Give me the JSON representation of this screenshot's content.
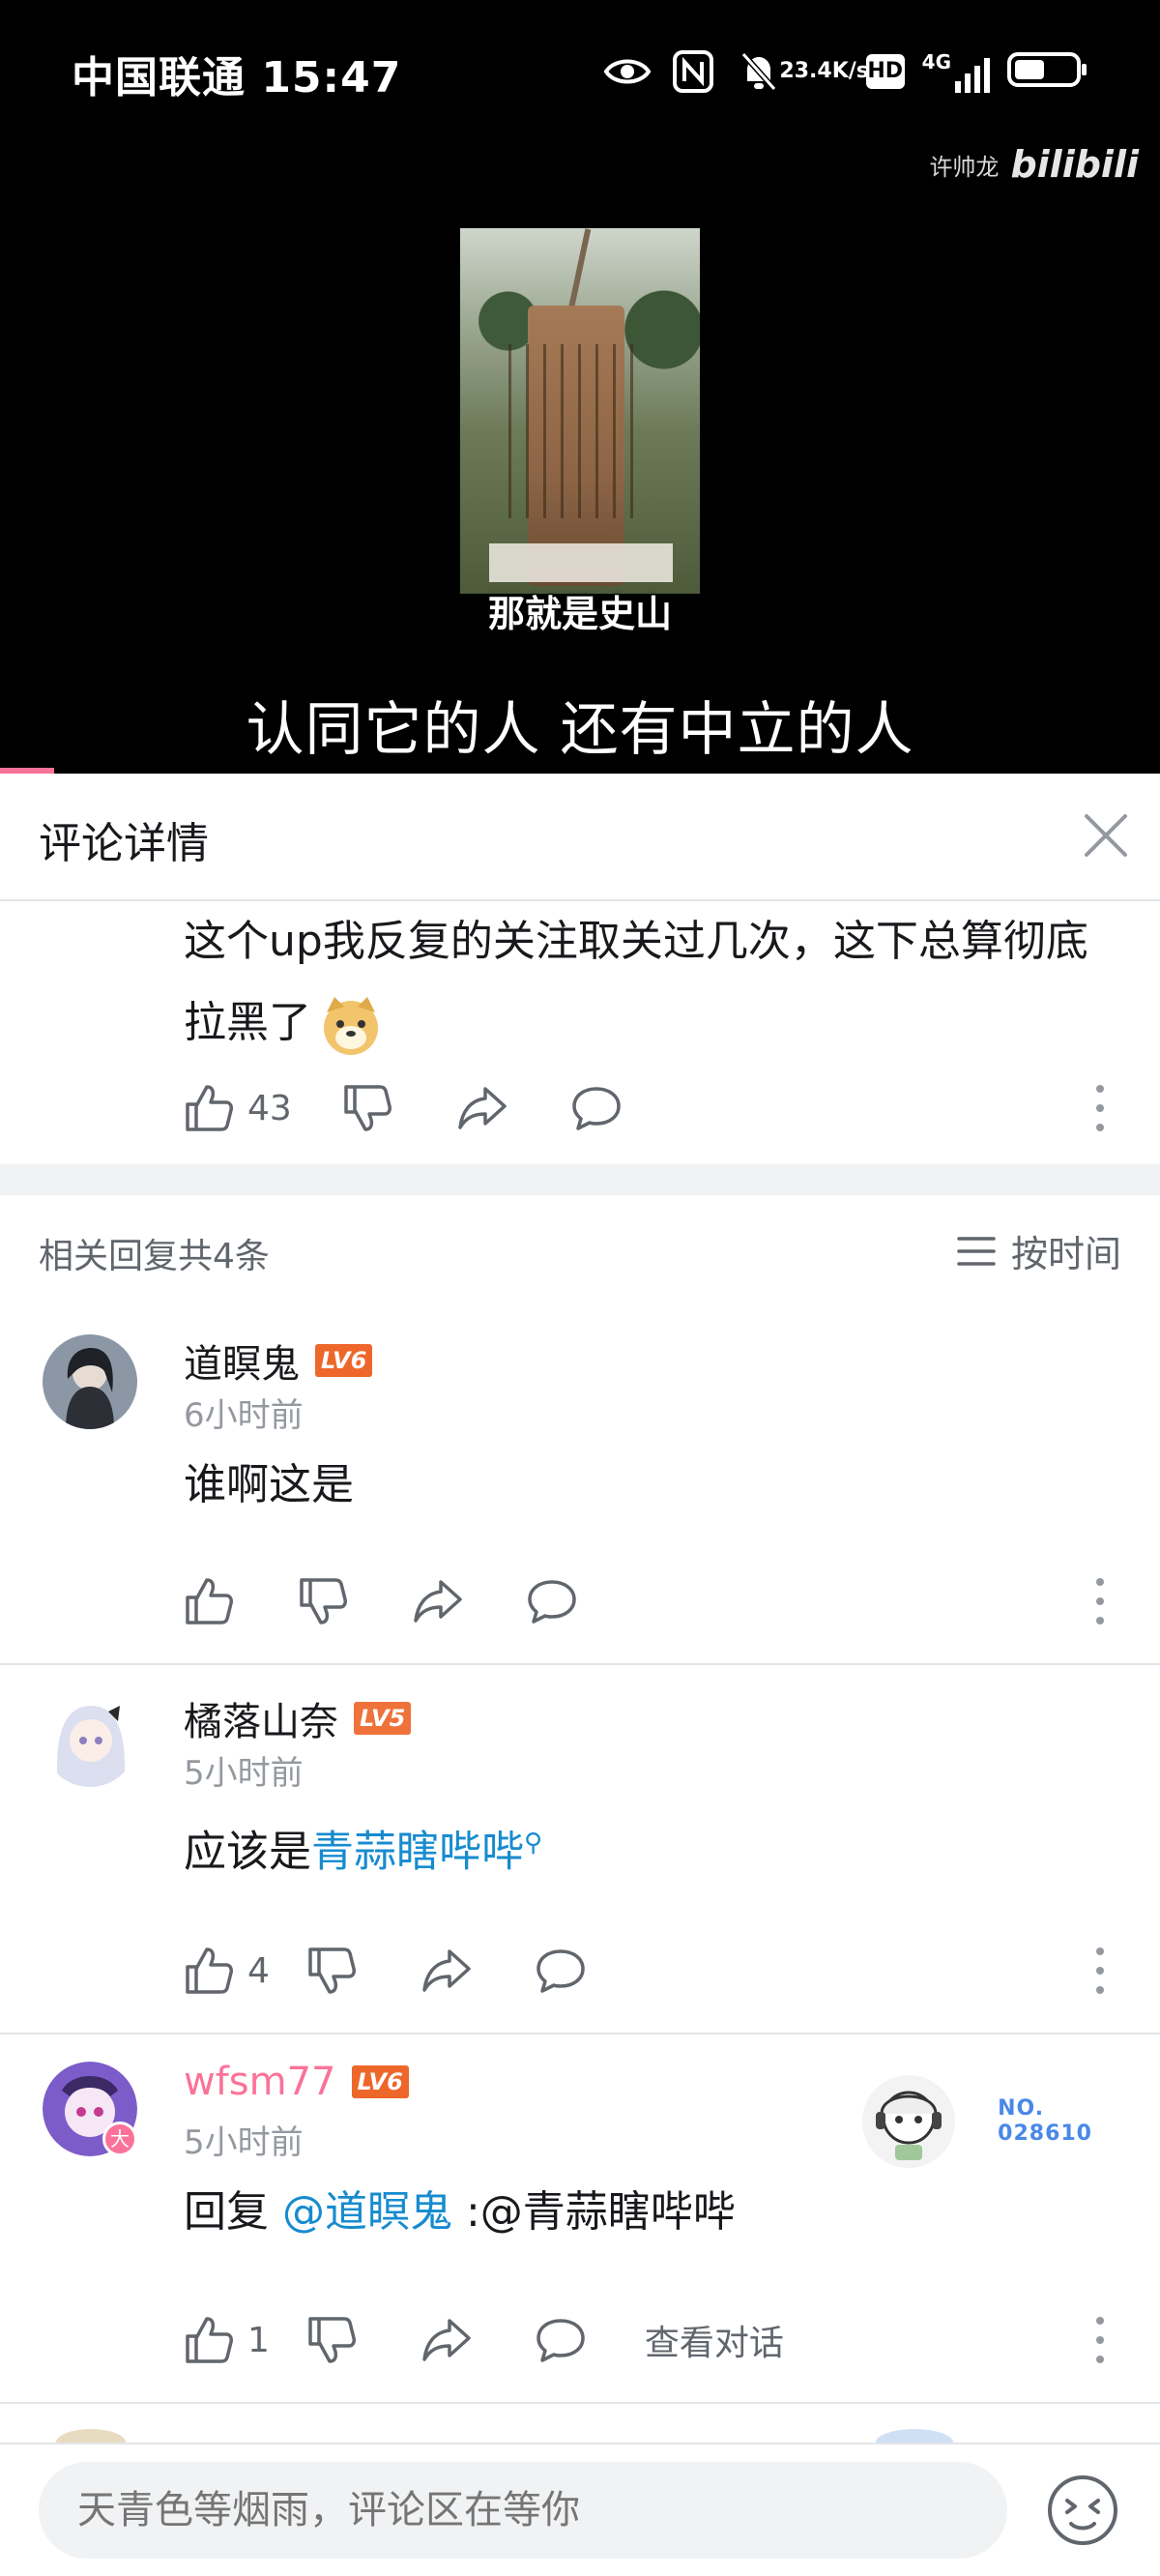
{
  "status_bar": {
    "carrier_time": "中国联通 15:47",
    "net_speed_top": "23.4",
    "net_speed_bottom": "K/s",
    "hd": "HD",
    "network": "4G"
  },
  "video": {
    "watermark_user": "许帅龙",
    "watermark_logo": "bilibili",
    "overlay_caption": "那就是史山",
    "subtitle": "认同它的人 还有中立的人"
  },
  "header": {
    "title": "评论详情"
  },
  "root_comment": {
    "text": "这个up我反复的关注取关过几次，这下总算彻底拉黑了",
    "likes": "43"
  },
  "replies_section": {
    "count_label": "相关回复共4条",
    "sort_label": "按时间"
  },
  "replies": [
    {
      "user": "道瞑鬼",
      "level": "LV6",
      "time": "6小时前",
      "text": "谁啊这是",
      "likes": ""
    },
    {
      "user": "橘落山奈",
      "level": "LV5",
      "time": "5小时前",
      "text_prefix": "应该是",
      "link": "青蒜瞎哔哔",
      "likes": "4"
    },
    {
      "user": "wfsm77",
      "level": "LV6",
      "time": "5小时前",
      "text_prefix": "回复 ",
      "mention": "@道瞑鬼",
      "text_suffix": " :@青蒜瞎哔哔",
      "likes": "1",
      "view_conversation": "查看对话",
      "badge_no": "NO.\n028610",
      "name_color": "#fb7299",
      "avatar_badge": "大"
    }
  ],
  "input": {
    "placeholder": "天青色等烟雨，评论区在等你"
  },
  "colors": {
    "accent_pink": "#fb7299",
    "link_blue": "#178bcf",
    "level_orange": "#ee672a"
  }
}
